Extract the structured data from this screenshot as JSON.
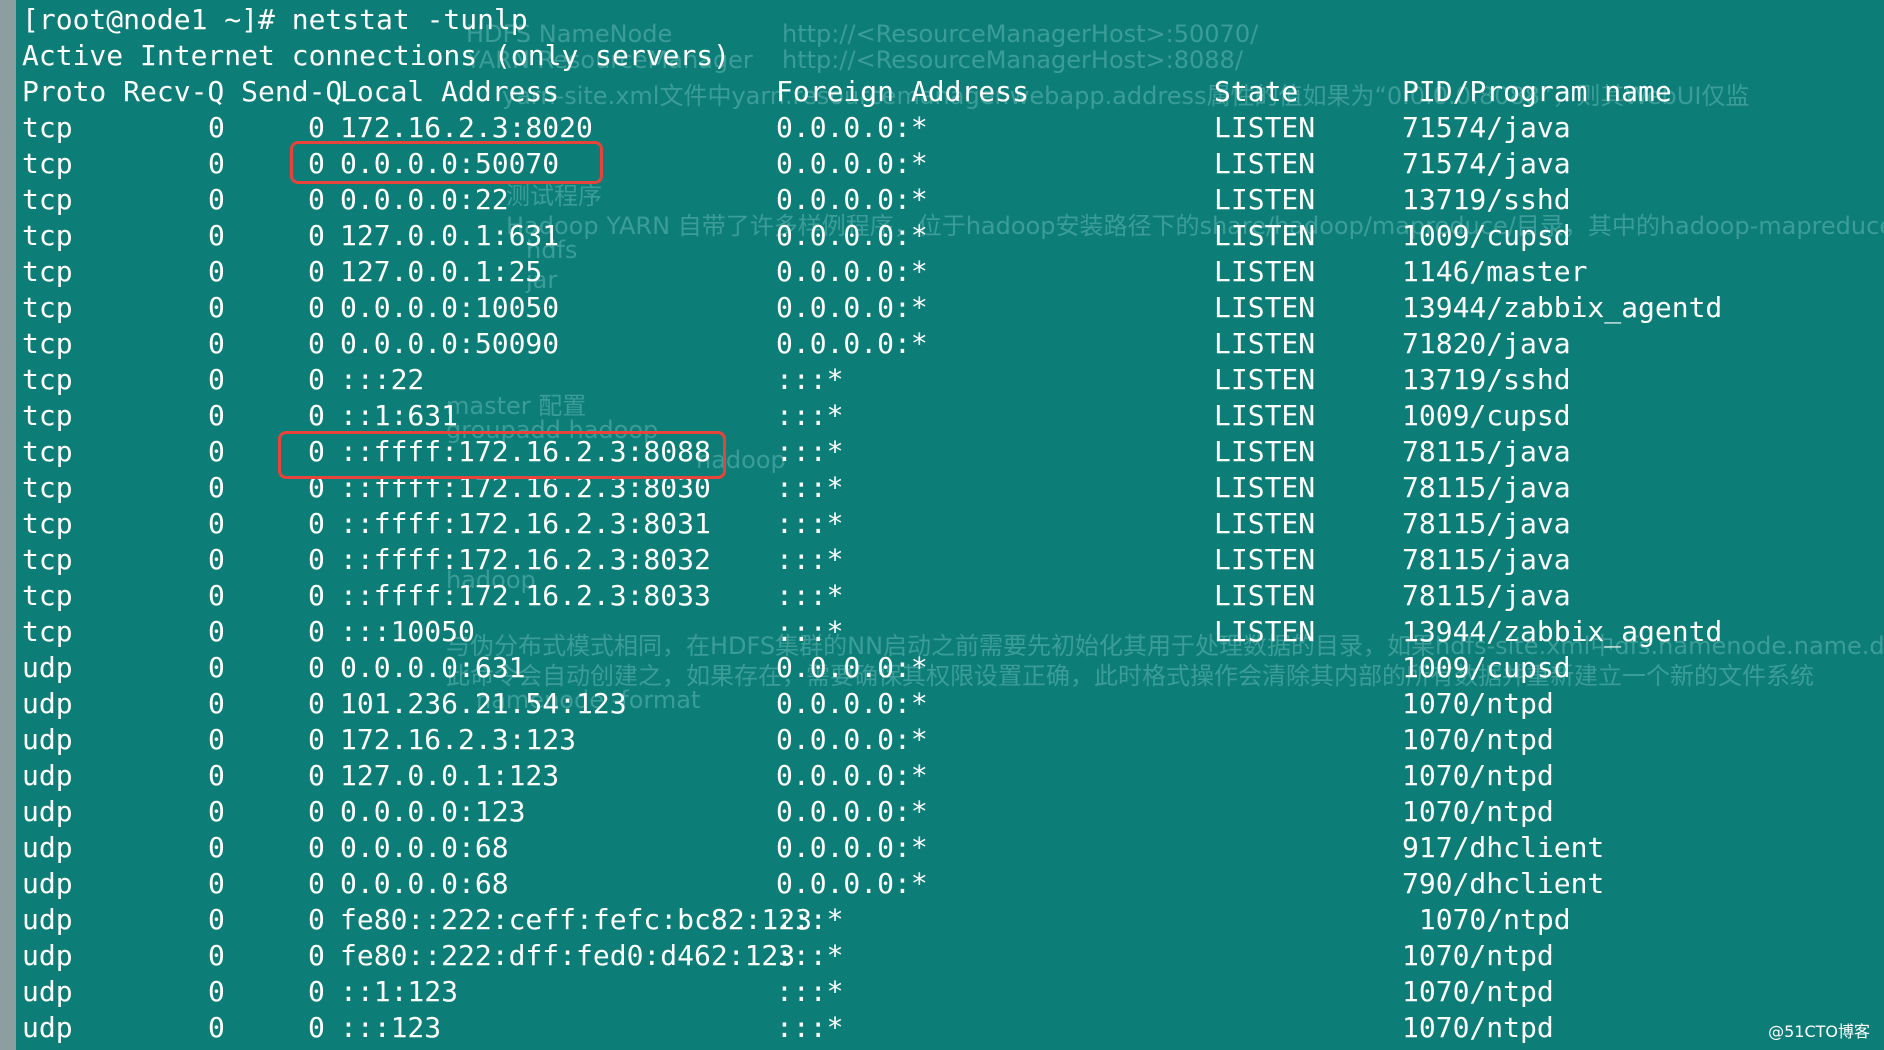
{
  "terminal": {
    "command_line": "[root@node1 ~]# netstat -tunlp",
    "subtitle": "Active Internet connections (only servers)",
    "headers": {
      "proto_recv_send": "Proto Recv-Q Send-Q",
      "local": "Local Address",
      "foreign": "Foreign Address",
      "state": "State",
      "pid": "PID/Program name"
    },
    "rows": [
      {
        "proto": "tcp",
        "recv": "0",
        "send": "0",
        "local": "172.16.2.3:8020",
        "foreign": "0.0.0.0:*",
        "state": "LISTEN",
        "pid": "71574/java"
      },
      {
        "proto": "tcp",
        "recv": "0",
        "send": "0",
        "local": "0.0.0.0:50070",
        "foreign": "0.0.0.0:*",
        "state": "LISTEN",
        "pid": "71574/java"
      },
      {
        "proto": "tcp",
        "recv": "0",
        "send": "0",
        "local": "0.0.0.0:22",
        "foreign": "0.0.0.0:*",
        "state": "LISTEN",
        "pid": "13719/sshd"
      },
      {
        "proto": "tcp",
        "recv": "0",
        "send": "0",
        "local": "127.0.0.1:631",
        "foreign": "0.0.0.0:*",
        "state": "LISTEN",
        "pid": "1009/cupsd"
      },
      {
        "proto": "tcp",
        "recv": "0",
        "send": "0",
        "local": "127.0.0.1:25",
        "foreign": "0.0.0.0:*",
        "state": "LISTEN",
        "pid": "1146/master"
      },
      {
        "proto": "tcp",
        "recv": "0",
        "send": "0",
        "local": "0.0.0.0:10050",
        "foreign": "0.0.0.0:*",
        "state": "LISTEN",
        "pid": "13944/zabbix_agentd"
      },
      {
        "proto": "tcp",
        "recv": "0",
        "send": "0",
        "local": "0.0.0.0:50090",
        "foreign": "0.0.0.0:*",
        "state": "LISTEN",
        "pid": "71820/java"
      },
      {
        "proto": "tcp",
        "recv": "0",
        "send": "0",
        "local": ":::22",
        "foreign": ":::*",
        "state": "LISTEN",
        "pid": "13719/sshd"
      },
      {
        "proto": "tcp",
        "recv": "0",
        "send": "0",
        "local": "::1:631",
        "foreign": ":::*",
        "state": "LISTEN",
        "pid": "1009/cupsd"
      },
      {
        "proto": "tcp",
        "recv": "0",
        "send": "0",
        "local": "::ffff:172.16.2.3:8088",
        "foreign": ":::*",
        "state": "LISTEN",
        "pid": "78115/java"
      },
      {
        "proto": "tcp",
        "recv": "0",
        "send": "0",
        "local": "::ffff:172.16.2.3:8030",
        "foreign": ":::*",
        "state": "LISTEN",
        "pid": "78115/java"
      },
      {
        "proto": "tcp",
        "recv": "0",
        "send": "0",
        "local": "::ffff:172.16.2.3:8031",
        "foreign": ":::*",
        "state": "LISTEN",
        "pid": "78115/java"
      },
      {
        "proto": "tcp",
        "recv": "0",
        "send": "0",
        "local": "::ffff:172.16.2.3:8032",
        "foreign": ":::*",
        "state": "LISTEN",
        "pid": "78115/java"
      },
      {
        "proto": "tcp",
        "recv": "0",
        "send": "0",
        "local": "::ffff:172.16.2.3:8033",
        "foreign": ":::*",
        "state": "LISTEN",
        "pid": "78115/java"
      },
      {
        "proto": "tcp",
        "recv": "0",
        "send": "0",
        "local": ":::10050",
        "foreign": ":::*",
        "state": "LISTEN",
        "pid": "13944/zabbix_agentd"
      },
      {
        "proto": "udp",
        "recv": "0",
        "send": "0",
        "local": "0.0.0.0:631",
        "foreign": "0.0.0.0:*",
        "state": "",
        "pid": "1009/cupsd"
      },
      {
        "proto": "udp",
        "recv": "0",
        "send": "0",
        "local": "101.236.21.54:123",
        "foreign": "0.0.0.0:*",
        "state": "",
        "pid": "1070/ntpd"
      },
      {
        "proto": "udp",
        "recv": "0",
        "send": "0",
        "local": "172.16.2.3:123",
        "foreign": "0.0.0.0:*",
        "state": "",
        "pid": "1070/ntpd"
      },
      {
        "proto": "udp",
        "recv": "0",
        "send": "0",
        "local": "127.0.0.1:123",
        "foreign": "0.0.0.0:*",
        "state": "",
        "pid": "1070/ntpd"
      },
      {
        "proto": "udp",
        "recv": "0",
        "send": "0",
        "local": "0.0.0.0:123",
        "foreign": "0.0.0.0:*",
        "state": "",
        "pid": "1070/ntpd"
      },
      {
        "proto": "udp",
        "recv": "0",
        "send": "0",
        "local": "0.0.0.0:68",
        "foreign": "0.0.0.0:*",
        "state": "",
        "pid": "917/dhclient"
      },
      {
        "proto": "udp",
        "recv": "0",
        "send": "0",
        "local": "0.0.0.0:68",
        "foreign": "0.0.0.0:*",
        "state": "",
        "pid": "790/dhclient"
      },
      {
        "proto": "udp",
        "recv": "0",
        "send": "0",
        "local": "fe80::222:ceff:fefc:bc82:123",
        "foreign": ":::*",
        "state": "",
        "pid": " 1070/ntpd"
      },
      {
        "proto": "udp",
        "recv": "0",
        "send": "0",
        "local": "fe80::222:dff:fed0:d462:123",
        "foreign": ":::*",
        "state": "",
        "pid": "1070/ntpd"
      },
      {
        "proto": "udp",
        "recv": "0",
        "send": "0",
        "local": "::1:123",
        "foreign": ":::*",
        "state": "",
        "pid": "1070/ntpd"
      },
      {
        "proto": "udp",
        "recv": "0",
        "send": "0",
        "local": ":::123",
        "foreign": ":::*",
        "state": "",
        "pid": "1070/ntpd"
      }
    ]
  },
  "ghost_text": [
    "HDFS NameNode",
    "http://<ResourceManagerHost>:50070/",
    "YARN ResourceManager",
    "http://<ResourceManagerHost>:8088/",
    "yarn-site.xml文件中yarn.resourcemanager.webapp.address属性的值如果为“0.0.0.0:8088”，则其WebUI仅监",
    "测试程序",
    "Hadoop YARN 自带了许多样例程序，位于hadoop安装路径下的share/hadoop/mapreduce/目录，其中的hadoop-mapreduce",
    "hdfs",
    "jar",
    "master 配置",
    "groupadd hadoop",
    "hadoop",
    "hadoop",
    "与伪分布式模式相同，在HDFS集群的NN启动之前需要先初始化其用于处理数据的目录，如果hdfs-site.xml中dfs.namenode.name.d",
    "此命令会自动创建之，如果存在，需要确保其权限设置正确，此时格式操作会清除其内部的所有数据并重新建立一个新的文件系统",
    "namenode -format"
  ],
  "watermark": "@51CTO博客",
  "colors": {
    "background": "#0d7d78",
    "text": "#ffffff",
    "highlight": "#e8433a"
  }
}
